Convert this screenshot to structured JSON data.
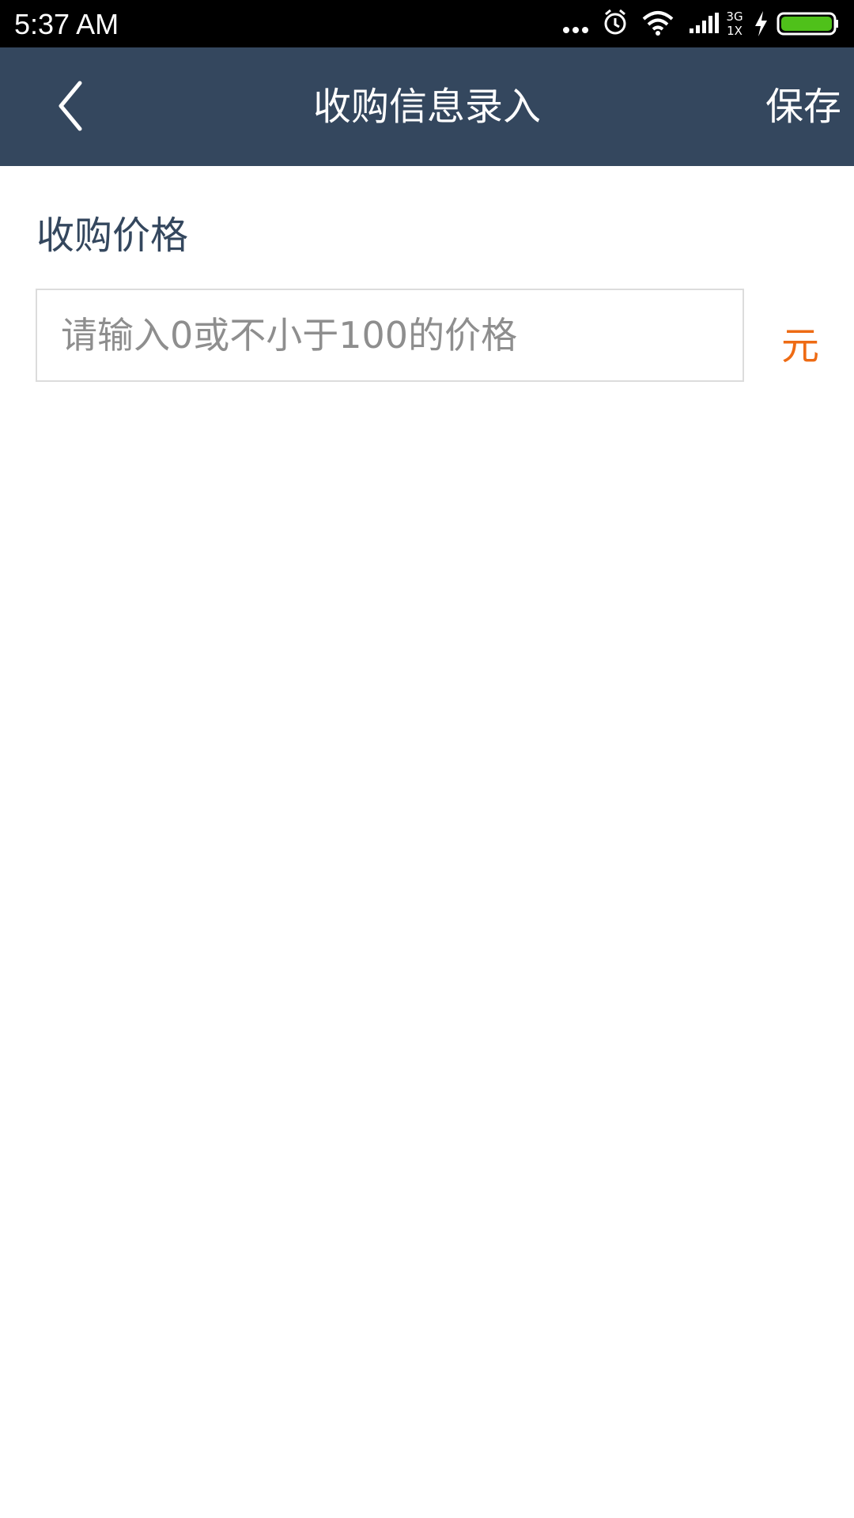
{
  "status_bar": {
    "time": "5:37 AM",
    "network_type_top": "3G",
    "network_type_bottom": "1X",
    "icons": [
      "more-dots-icon",
      "alarm-icon",
      "wifi-icon",
      "signal-icon",
      "charging-icon",
      "battery-icon"
    ],
    "battery_level": 1.0,
    "battery_color": "#4fc11a"
  },
  "header": {
    "title": "收购信息录入",
    "save_label": "保存",
    "back_icon": "chevron-left-icon",
    "background_color": "#34475e"
  },
  "form": {
    "price_label": "收购价格",
    "price_input": {
      "value": "",
      "placeholder": "请输入0或不小于100的价格"
    },
    "unit": "元",
    "unit_color": "#ee6b14"
  }
}
